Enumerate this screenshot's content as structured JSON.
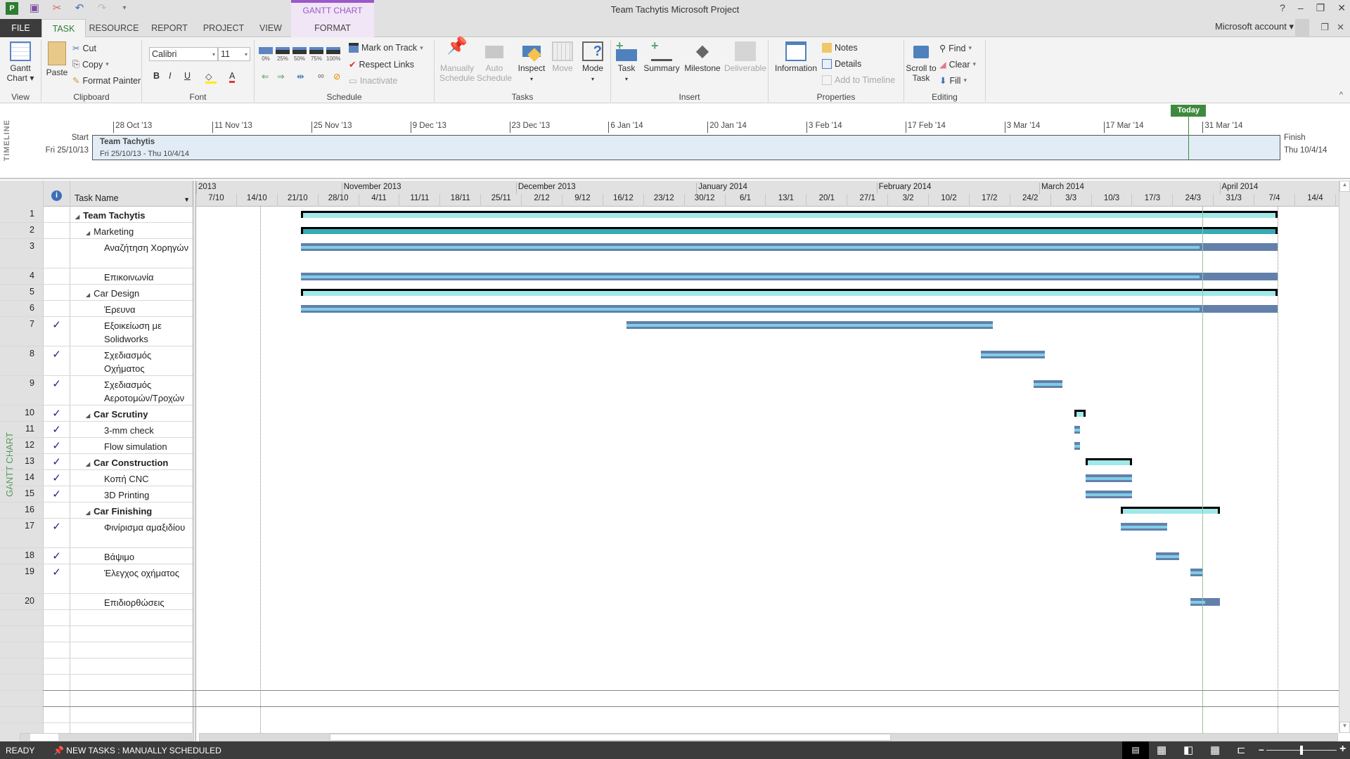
{
  "window": {
    "title": "Team Tachytis   Microsoft Project",
    "context_tab_group": "GANTT CHART TOOLS",
    "account": "Microsoft account",
    "controls": [
      "?",
      "–",
      "❐",
      "✕"
    ]
  },
  "tabs": [
    "FILE",
    "TASK",
    "RESOURCE",
    "REPORT",
    "PROJECT",
    "VIEW",
    "FORMAT"
  ],
  "active_tab": "TASK",
  "ribbon": {
    "view": {
      "label": "View",
      "gantt_chart": "Gantt Chart ▾"
    },
    "clipboard": {
      "label": "Clipboard",
      "paste": "Paste",
      "cut": "Cut",
      "copy": "Copy",
      "format_painter": "Format Painter"
    },
    "font": {
      "label": "Font",
      "font_name": "Calibri",
      "font_size": "11",
      "bold": "B",
      "italic": "I",
      "underline": "U",
      "font_color": "A"
    },
    "schedule": {
      "label": "Schedule",
      "percents": [
        "0%",
        "25%",
        "50%",
        "75%",
        "100%"
      ],
      "mark_on_track": "Mark on Track",
      "respect_links": "Respect Links",
      "inactivate": "Inactivate"
    },
    "tasks": {
      "label": "Tasks",
      "manually_schedule": "Manually Schedule",
      "auto_schedule": "Auto Schedule",
      "inspect": "Inspect",
      "move": "Move",
      "mode": "Mode"
    },
    "insert": {
      "label": "Insert",
      "task": "Task",
      "summary": "Summary",
      "milestone": "Milestone",
      "deliverable": "Deliverable"
    },
    "properties": {
      "label": "Properties",
      "information": "Information",
      "notes": "Notes",
      "details": "Details",
      "add_to_timeline": "Add to Timeline"
    },
    "editing": {
      "label": "Editing",
      "scroll_to_task": "Scroll to Task",
      "find": "Find",
      "clear": "Clear",
      "fill": "Fill"
    }
  },
  "timeline": {
    "label": "TIMELINE",
    "start_label": "Start",
    "start_date": "Fri 25/10/13",
    "finish_label": "Finish",
    "finish_date": "Thu 10/4/14",
    "bar_title": "Team Tachytis",
    "bar_range": "Fri 25/10/13 - Thu 10/4/14",
    "today_label": "Today",
    "ticks": [
      {
        "label": "28 Oct '13",
        "date": "2013-10-28"
      },
      {
        "label": "11 Nov '13",
        "date": "2013-11-11"
      },
      {
        "label": "25 Nov '13",
        "date": "2013-11-25"
      },
      {
        "label": "9 Dec '13",
        "date": "2013-12-09"
      },
      {
        "label": "23 Dec '13",
        "date": "2013-12-23"
      },
      {
        "label": "6 Jan '14",
        "date": "2014-01-06"
      },
      {
        "label": "20 Jan '14",
        "date": "2014-01-20"
      },
      {
        "label": "3 Feb '14",
        "date": "2014-02-03"
      },
      {
        "label": "17 Feb '14",
        "date": "2014-02-17"
      },
      {
        "label": "3 Mar '14",
        "date": "2014-03-03"
      },
      {
        "label": "17 Mar '14",
        "date": "2014-03-17"
      },
      {
        "label": "31 Mar '14",
        "date": "2014-03-31"
      }
    ]
  },
  "gantt": {
    "view_label": "GANTT CHART",
    "columns": {
      "indicators_icon": "info-icon",
      "task_name": "Task Name"
    },
    "months": [
      {
        "label": "2013",
        "date": "2013-10-07"
      },
      {
        "label": "November 2013",
        "date": "2013-11-01"
      },
      {
        "label": "December 2013",
        "date": "2013-12-01"
      },
      {
        "label": "January 2014",
        "date": "2014-01-01"
      },
      {
        "label": "February 2014",
        "date": "2014-02-01"
      },
      {
        "label": "March 2014",
        "date": "2014-03-01"
      },
      {
        "label": "April 2014",
        "date": "2014-04-01"
      }
    ],
    "weeks": [
      "7/10",
      "14/10",
      "21/10",
      "28/10",
      "4/11",
      "11/11",
      "18/11",
      "25/11",
      "2/12",
      "9/12",
      "16/12",
      "23/12",
      "30/12",
      "6/1",
      "13/1",
      "20/1",
      "27/1",
      "3/2",
      "10/2",
      "17/2",
      "24/2",
      "3/3",
      "10/3",
      "17/3",
      "24/3",
      "31/3",
      "7/4",
      "14/4"
    ],
    "colors": {
      "task": "#6380ab",
      "progress": "#7fcde6",
      "summary": "#a0e8ea",
      "summary_selected": "#35abb5",
      "today": "#9ac59a"
    },
    "tasks": [
      {
        "id": "1",
        "name": "Team Tachytis",
        "level": 0,
        "summary": true,
        "bold": true,
        "done": false,
        "start": "2013-10-25",
        "finish": "2014-04-10"
      },
      {
        "id": "2",
        "name": "Marketing",
        "level": 1,
        "summary": true,
        "selected": true,
        "done": false,
        "start": "2013-10-25",
        "finish": "2014-04-10"
      },
      {
        "id": "3",
        "name": "Αναζήτηση Χορηγών",
        "level": 2,
        "tall": true,
        "done": false,
        "start": "2013-10-25",
        "finish": "2014-04-10",
        "complete": 92
      },
      {
        "id": "4",
        "name": "Επικοινωνία",
        "level": 2,
        "done": false,
        "start": "2013-10-25",
        "finish": "2014-04-10",
        "complete": 92
      },
      {
        "id": "5",
        "name": "Car Design",
        "level": 1,
        "summary": true,
        "done": false,
        "start": "2013-10-25",
        "finish": "2014-04-10"
      },
      {
        "id": "6",
        "name": "Έρευνα",
        "level": 2,
        "done": false,
        "start": "2013-10-25",
        "finish": "2014-04-10",
        "complete": 92
      },
      {
        "id": "7",
        "name": "Εξοικείωση με Solidworks",
        "level": 2,
        "tall": true,
        "done": true,
        "start": "2013-12-20",
        "finish": "2014-02-20",
        "complete": 100
      },
      {
        "id": "8",
        "name": "Σχεδιασμός Οχήματος",
        "level": 2,
        "tall": true,
        "done": true,
        "start": "2014-02-19",
        "finish": "2014-03-01",
        "complete": 100
      },
      {
        "id": "9",
        "name": "Σχεδιασμός Αεροτομών/Τροχών",
        "level": 2,
        "tall": true,
        "done": true,
        "start": "2014-02-28",
        "finish": "2014-03-04",
        "complete": 100
      },
      {
        "id": "10",
        "name": "Car Scrutiny",
        "level": 1,
        "summary": true,
        "bold": true,
        "done": true,
        "start": "2014-03-07",
        "finish": "2014-03-08"
      },
      {
        "id": "11",
        "name": "3-mm check",
        "level": 2,
        "done": true,
        "start": "2014-03-07",
        "finish": "2014-03-07",
        "complete": 100
      },
      {
        "id": "12",
        "name": "Flow simulation",
        "level": 2,
        "done": true,
        "start": "2014-03-07",
        "finish": "2014-03-07",
        "complete": 100
      },
      {
        "id": "13",
        "name": "Car Construction",
        "level": 1,
        "summary": true,
        "bold": true,
        "done": true,
        "start": "2014-03-09",
        "finish": "2014-03-16"
      },
      {
        "id": "14",
        "name": "Κοπή CNC",
        "level": 2,
        "done": true,
        "start": "2014-03-09",
        "finish": "2014-03-16",
        "complete": 100
      },
      {
        "id": "15",
        "name": "3D Printing",
        "level": 2,
        "done": true,
        "start": "2014-03-09",
        "finish": "2014-03-16",
        "complete": 100
      },
      {
        "id": "16",
        "name": "Car Finishing",
        "level": 1,
        "summary": true,
        "bold": true,
        "done": false,
        "start": "2014-03-15",
        "finish": "2014-03-31"
      },
      {
        "id": "17",
        "name": "Φινίρισμα αμαξιδίου",
        "level": 2,
        "tall": true,
        "done": true,
        "start": "2014-03-15",
        "finish": "2014-03-22",
        "complete": 100
      },
      {
        "id": "18",
        "name": "Βάψιμο",
        "level": 2,
        "done": true,
        "start": "2014-03-21",
        "finish": "2014-03-24",
        "complete": 100
      },
      {
        "id": "19",
        "name": "Έλεγχος οχήματος",
        "level": 2,
        "tall": true,
        "done": true,
        "start": "2014-03-27",
        "finish": "2014-03-28",
        "complete": 100
      },
      {
        "id": "20",
        "name": "Επιδιορθώσεις",
        "level": 2,
        "done": false,
        "start": "2014-03-27",
        "finish": "2014-03-31",
        "complete": 50
      }
    ]
  },
  "status": {
    "ready": "READY",
    "new_tasks": "NEW TASKS : MANUALLY SCHEDULED",
    "zoom_minus": "–",
    "zoom_plus": "+",
    "zoom_level": 0.5
  }
}
